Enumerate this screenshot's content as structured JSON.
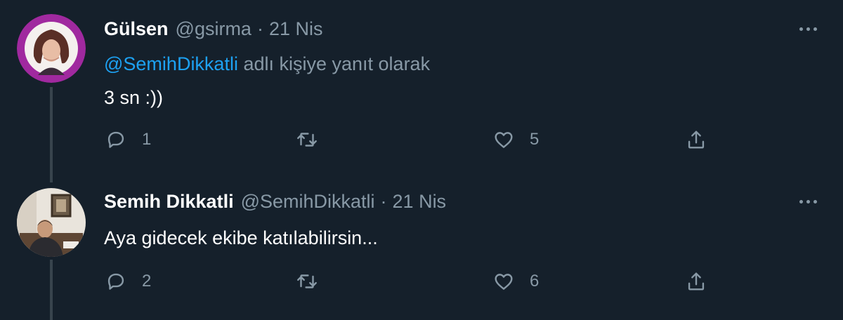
{
  "tweets": [
    {
      "name": "Gülsen",
      "handle": "@gsirma",
      "separator": "·",
      "date": "21 Nis",
      "reply_mention": "@SemihDikkatli",
      "reply_suffix": " adlı kişiye yanıt olarak",
      "text": "3 sn :))",
      "reply_count": "1",
      "retweet_count": "",
      "like_count": "5"
    },
    {
      "name": "Semih Dikkatli",
      "handle": "@SemihDikkatli",
      "separator": "·",
      "date": "21 Nis",
      "text": "Aya gidecek ekibe katılabilirsin...",
      "reply_count": "2",
      "retweet_count": "",
      "like_count": "6"
    }
  ],
  "icons": {
    "more": "more-dots-icon",
    "reply": "reply-icon",
    "retweet": "retweet-icon",
    "like": "heart-icon",
    "share": "share-icon"
  },
  "colors": {
    "background": "#15202b",
    "muted": "#8899a6",
    "link": "#1da1f2",
    "thread_line": "#38444d"
  }
}
